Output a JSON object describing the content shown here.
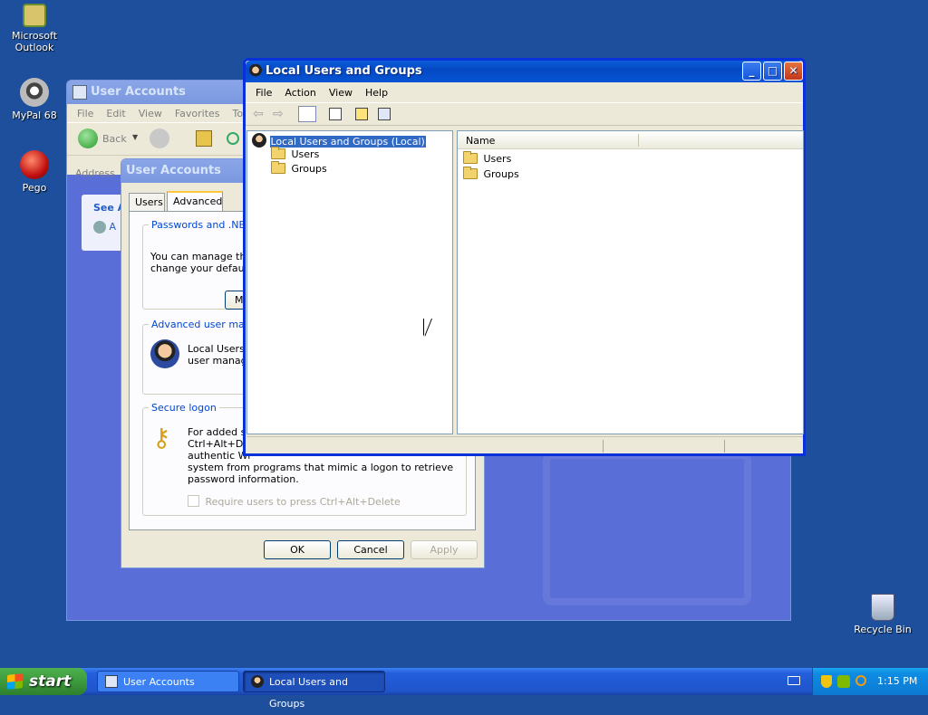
{
  "desktop": {
    "icons": [
      {
        "label": "Microsoft Outlook",
        "icon": "outlook-icon"
      },
      {
        "label": "MyPal 68",
        "icon": "raccoon-icon"
      },
      {
        "label": "Pego",
        "icon": "red-ball-icon"
      },
      {
        "label": "Recycle Bin",
        "icon": "recycle-bin-icon"
      }
    ]
  },
  "control_panel": {
    "title": "User Accounts",
    "menu": [
      "File",
      "Edit",
      "View",
      "Favorites",
      "Too"
    ],
    "back_label": "Back",
    "address_label": "Address",
    "side_heading": "See A",
    "side_item": "A"
  },
  "user_accounts_dialog": {
    "title": "User Accounts",
    "tabs": [
      "Users",
      "Advanced"
    ],
    "active_tab": "Advanced",
    "passwords_group": {
      "legend": "Passwords and .NET",
      "text_line1": "You can manage the",
      "text_line2": "change your default",
      "button_label": "M"
    },
    "advanced_group": {
      "legend": "Advanced user mana",
      "text_line1": "Local Users a",
      "text_line2": "user manage"
    },
    "secure_group": {
      "legend": "Secure logon",
      "text_line1": "For added se",
      "text_line2": "Ctrl+Alt+Del",
      "text_line3": "authentic Wi",
      "text_line4": "system from programs that mimic a logon to retrieve",
      "text_line5": "password information.",
      "checkbox_label": "Require users to press Ctrl+Alt+Delete",
      "checkbox_checked": false
    },
    "ok_label": "OK",
    "cancel_label": "Cancel",
    "apply_label": "Apply"
  },
  "lusrmgr": {
    "title": "Local Users and Groups",
    "menu": [
      "File",
      "Action",
      "View",
      "Help"
    ],
    "tree": {
      "root": "Local Users and Groups (Local)",
      "children": [
        "Users",
        "Groups"
      ]
    },
    "list": {
      "column_header": "Name",
      "items": [
        "Users",
        "Groups"
      ]
    }
  },
  "taskbar": {
    "start_label": "start",
    "tasks": [
      {
        "label": "User Accounts",
        "active": false
      },
      {
        "label": "Local Users and Groups",
        "active": true
      }
    ],
    "clock": "1:15 PM"
  },
  "colors": {
    "desktop": "#1d4f9c",
    "taskbar": "#245edb",
    "start": "#3c9a3c",
    "tray": "#0f8ce3",
    "selection": "#316ac5"
  }
}
